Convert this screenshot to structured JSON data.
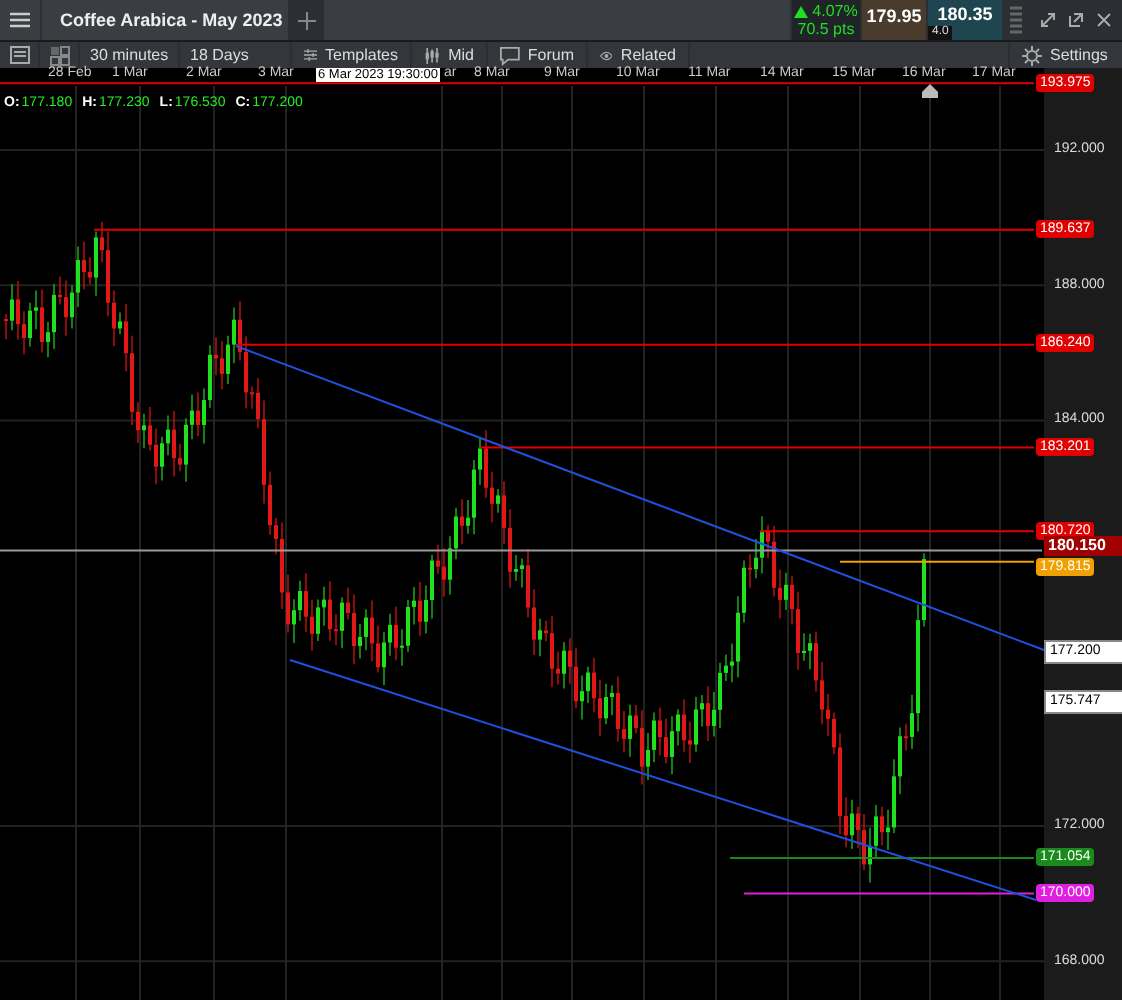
{
  "header": {
    "title": "Coffee Arabica - May 2023",
    "change": "4.07%",
    "change_pts": "70.5 pts",
    "sell": "179.95",
    "buy": "180.35",
    "spread": "4.0"
  },
  "toolbar": {
    "interval": "30 minutes",
    "range": "18 Days",
    "buttons": [
      {
        "label": "Templates",
        "kind": "templates"
      },
      {
        "label": "Mid",
        "kind": "mid"
      },
      {
        "label": "Forum",
        "kind": "forum"
      },
      {
        "label": "Related",
        "kind": "related"
      }
    ],
    "settings": "Settings"
  },
  "time_axis": {
    "labels": [
      "28 Feb",
      "1 Mar",
      "2 Mar",
      "3 Mar",
      "ar",
      "8 Mar",
      "9 Mar",
      "10 Mar",
      "11 Mar",
      "14 Mar",
      "15 Mar",
      "16 Mar",
      "17 Mar"
    ],
    "crosshair_time": "6 Mar 2023 19:30:00"
  },
  "ohlc": [
    {
      "label": "O:",
      "value": "177.180"
    },
    {
      "label": "H:",
      "value": "177.230"
    },
    {
      "label": "L:",
      "value": "176.530"
    },
    {
      "label": "C:",
      "value": "177.200"
    }
  ],
  "price_axis": {
    "ticks": [
      "192.000",
      "188.000",
      "184.000",
      "172.000",
      "168.000"
    ]
  },
  "levels": [
    {
      "price": "193.975",
      "kind": "alert",
      "color": "#e00000"
    },
    {
      "price": "189.637",
      "kind": "alert",
      "color": "#e00000"
    },
    {
      "price": "186.240",
      "kind": "alert",
      "color": "#e00000"
    },
    {
      "price": "183.201",
      "kind": "alert",
      "color": "#e00000"
    },
    {
      "price": "180.720",
      "kind": "alert",
      "color": "#e00000"
    },
    {
      "price": "180.150",
      "kind": "current",
      "color": "#a00000"
    },
    {
      "price": "179.815",
      "kind": "alert",
      "color": "#f0a000"
    },
    {
      "price": "177.200",
      "kind": "marker",
      "color": "#ffffff"
    },
    {
      "price": "175.747",
      "kind": "marker",
      "color": "#ffffff"
    },
    {
      "price": "171.054",
      "kind": "alert",
      "color": "#1a8a1a"
    },
    {
      "price": "170.000",
      "kind": "alert",
      "color": "#e020e0"
    }
  ]
}
